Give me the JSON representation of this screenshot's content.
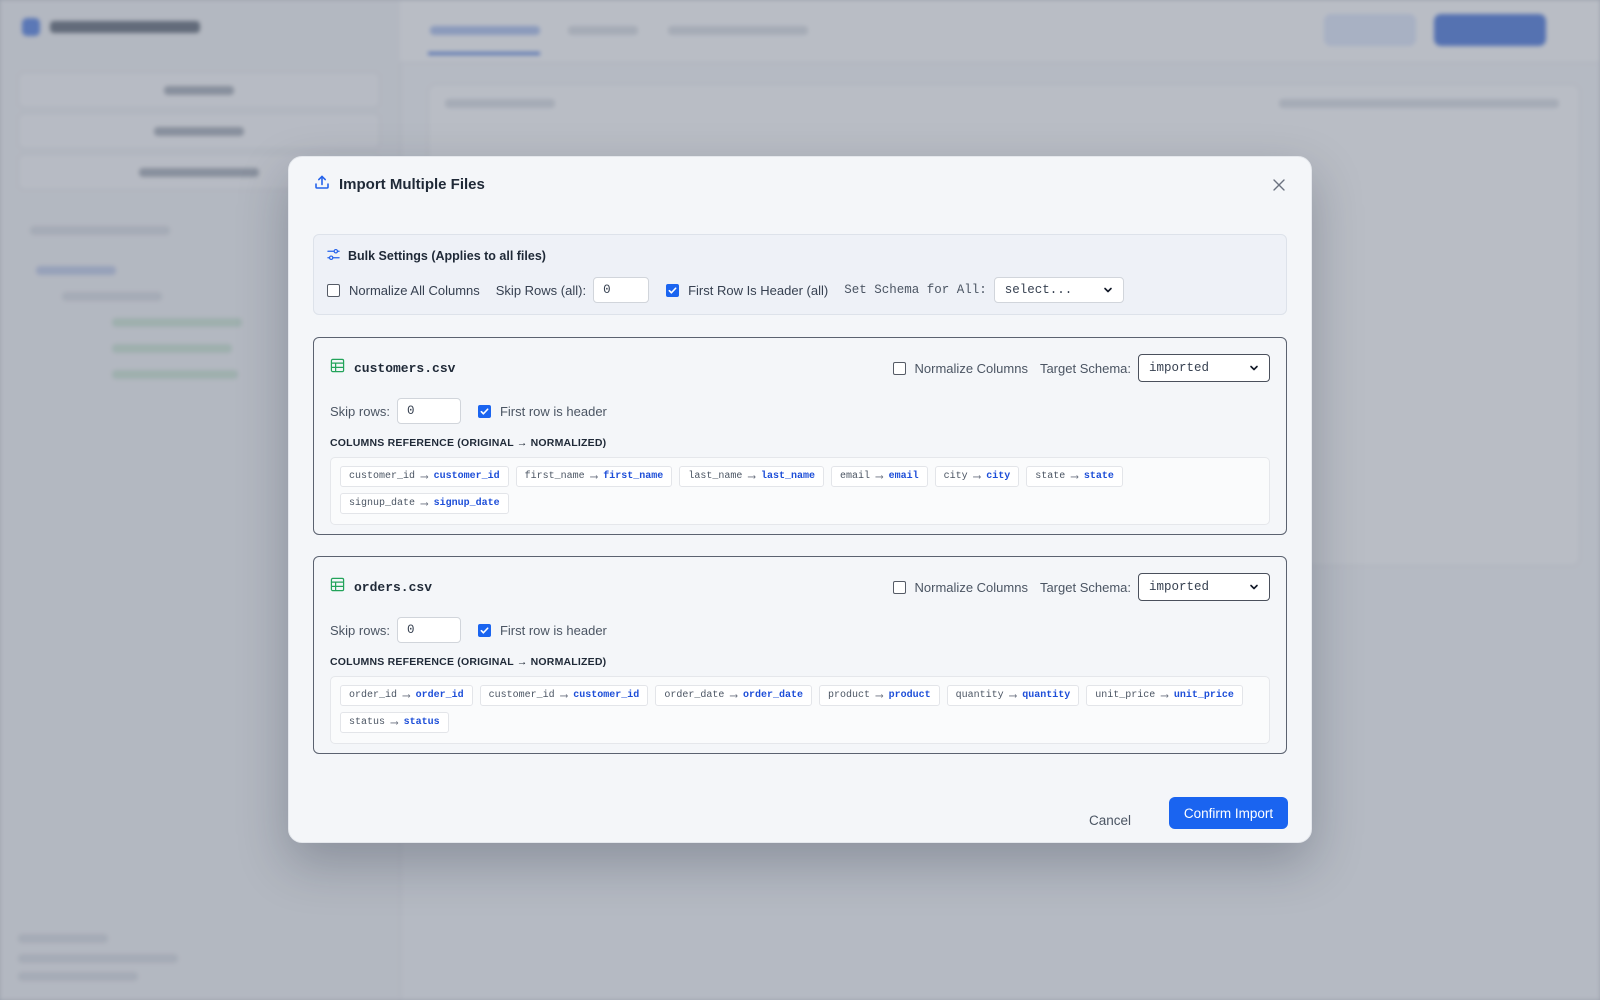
{
  "modal": {
    "title": "Import Multiple Files",
    "cancel_label": "Cancel",
    "confirm_label": "Confirm Import"
  },
  "bulk": {
    "title": "Bulk Settings (Applies to all files)",
    "normalize_label": "Normalize All Columns",
    "normalize_checked": false,
    "skip_rows_label": "Skip Rows (all):",
    "skip_rows_value": "0",
    "first_row_header_label": "First Row Is Header (all)",
    "first_row_header_checked": true,
    "schema_label": "Set Schema for All:",
    "schema_value": "select..."
  },
  "files": [
    {
      "name": "customers.csv",
      "normalize_label": "Normalize Columns",
      "normalize_checked": false,
      "target_schema_label": "Target Schema:",
      "target_schema_value": "imported",
      "skip_rows_label": "Skip rows:",
      "skip_rows_value": "0",
      "first_row_header_label": "First row is header",
      "first_row_header_checked": true,
      "columns_label": "COLUMNS REFERENCE (ORIGINAL → NORMALIZED)",
      "columns": [
        {
          "original": "customer_id",
          "normalized": "customer_id"
        },
        {
          "original": "first_name",
          "normalized": "first_name"
        },
        {
          "original": "last_name",
          "normalized": "last_name"
        },
        {
          "original": "email",
          "normalized": "email"
        },
        {
          "original": "city",
          "normalized": "city"
        },
        {
          "original": "state",
          "normalized": "state"
        },
        {
          "original": "signup_date",
          "normalized": "signup_date"
        }
      ]
    },
    {
      "name": "orders.csv",
      "normalize_label": "Normalize Columns",
      "normalize_checked": false,
      "target_schema_label": "Target Schema:",
      "target_schema_value": "imported",
      "skip_rows_label": "Skip rows:",
      "skip_rows_value": "0",
      "first_row_header_label": "First row is header",
      "first_row_header_checked": true,
      "columns_label": "COLUMNS REFERENCE (ORIGINAL → NORMALIZED)",
      "columns": [
        {
          "original": "order_id",
          "normalized": "order_id"
        },
        {
          "original": "customer_id",
          "normalized": "customer_id"
        },
        {
          "original": "order_date",
          "normalized": "order_date"
        },
        {
          "original": "product",
          "normalized": "product"
        },
        {
          "original": "quantity",
          "normalized": "quantity"
        },
        {
          "original": "unit_price",
          "normalized": "unit_price"
        },
        {
          "original": "status",
          "normalized": "status"
        }
      ]
    }
  ],
  "colors": {
    "accent": "#1a64f0",
    "normalized_text": "#1d4ed8",
    "file_icon": "#22a35a",
    "overlay": "#78808f"
  },
  "icons": {
    "title": "upload-icon",
    "close": "close-icon",
    "bulk": "sliders-icon",
    "file": "table-icon",
    "select": "chevron-down-icon"
  }
}
